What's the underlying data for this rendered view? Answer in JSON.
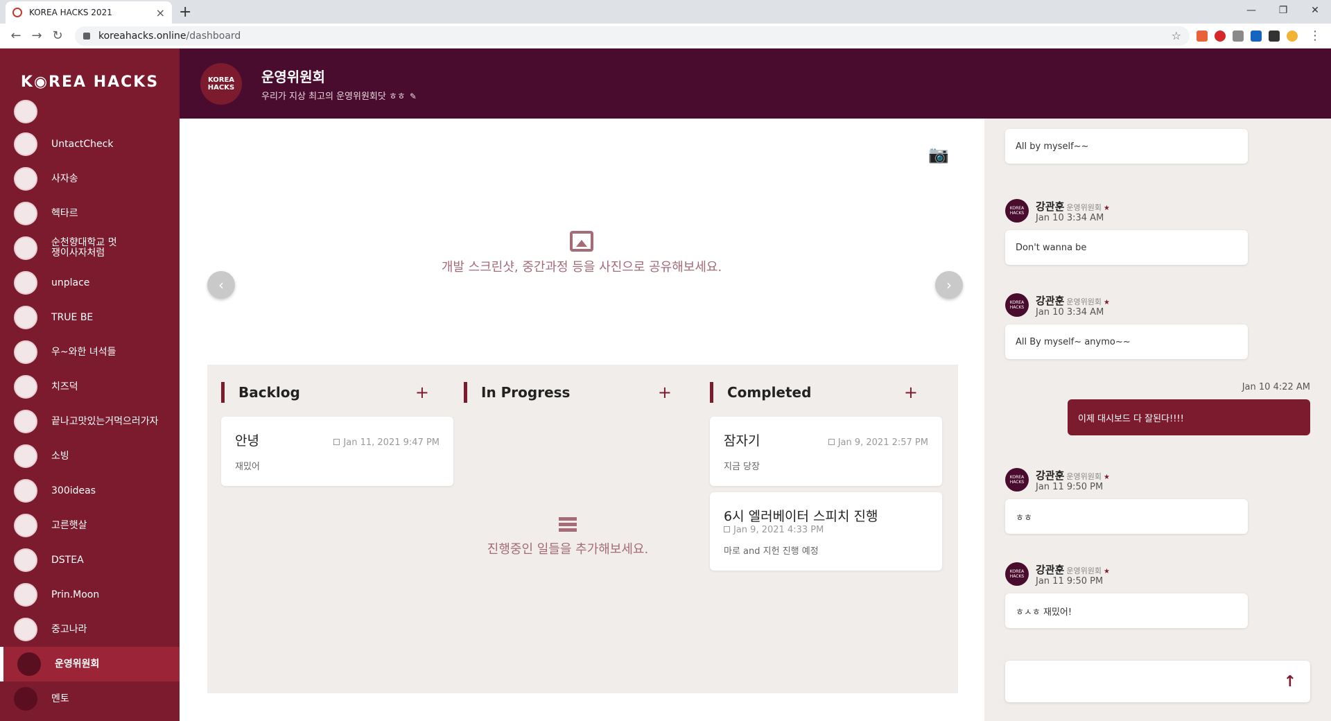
{
  "browser": {
    "tab_title": "KOREA HACKS 2021",
    "url_host": "koreahacks.online",
    "url_path": "/dashboard"
  },
  "sidebar": {
    "logo": "K◉REA HACKS",
    "teams": [
      {
        "name": "UntactCheck"
      },
      {
        "name": "사자송"
      },
      {
        "name": "헥타르"
      },
      {
        "name": "순천향대학교 멋쟁이사자처럼"
      },
      {
        "name": "unplace"
      },
      {
        "name": "TRUE BE"
      },
      {
        "name": "우~와한 녀석들"
      },
      {
        "name": "치즈덕"
      },
      {
        "name": "끝나고맛있는거먹으러가자"
      },
      {
        "name": "소빙"
      },
      {
        "name": "300ideas"
      },
      {
        "name": "고른햇살"
      },
      {
        "name": "DSTEA"
      },
      {
        "name": "Prin.Moon"
      },
      {
        "name": "중고나라"
      },
      {
        "name": "운영위원회"
      },
      {
        "name": "멘토"
      }
    ]
  },
  "header": {
    "logo_text": "KOREA HACKS",
    "title": "운영위원회",
    "subtitle": "우리가 지상 최고의 운영위원회닷 ㅎㅎ"
  },
  "gallery": {
    "empty_text": "개발 스크린샷, 중간과정 등을 사진으로 공유해보세요."
  },
  "board": {
    "columns": [
      {
        "title": "Backlog",
        "cards": [
          {
            "title": "안녕",
            "date": "Jan 11, 2021 9:47 PM",
            "desc": "재밌어"
          }
        ]
      },
      {
        "title": "In Progress",
        "empty_text": "진행중인 일들을 추가해보세요."
      },
      {
        "title": "Completed",
        "cards": [
          {
            "title": "잠자기",
            "date": "Jan 9, 2021 2:57 PM",
            "desc": "지금 당장"
          },
          {
            "title": "6시 엘러베이터 스피치 진행",
            "date": "Jan 9, 2021 4:33 PM",
            "desc": "마로 and 지헌 진행 예정"
          }
        ]
      }
    ]
  },
  "chat": {
    "first_bubble": "All by myself~~",
    "messages": [
      {
        "author": "강관훈",
        "team": "운영위원회",
        "time": "Jan 10 3:34 AM",
        "text": "Don't wanna be"
      },
      {
        "author": "강관훈",
        "team": "운영위원회",
        "time": "Jan 10 3:34 AM",
        "text": "All By myself~ anymo~~"
      },
      {
        "author": "강관훈",
        "team": "운영위원회",
        "time": "Jan 11 9:50 PM",
        "text": "ㅎㅎ"
      },
      {
        "author": "강관훈",
        "team": "운영위원회",
        "time": "Jan 11 9:50 PM",
        "text": "ㅎㅅㅎ 재밌어!"
      }
    ],
    "own_time": "Jan 10 4:22 AM",
    "own_text": "이제 대시보드 다 잘된다!!!!"
  },
  "colors": {
    "brand": "#7c1b2d",
    "header": "#4a0c2e",
    "board_bg": "#f0edea"
  }
}
